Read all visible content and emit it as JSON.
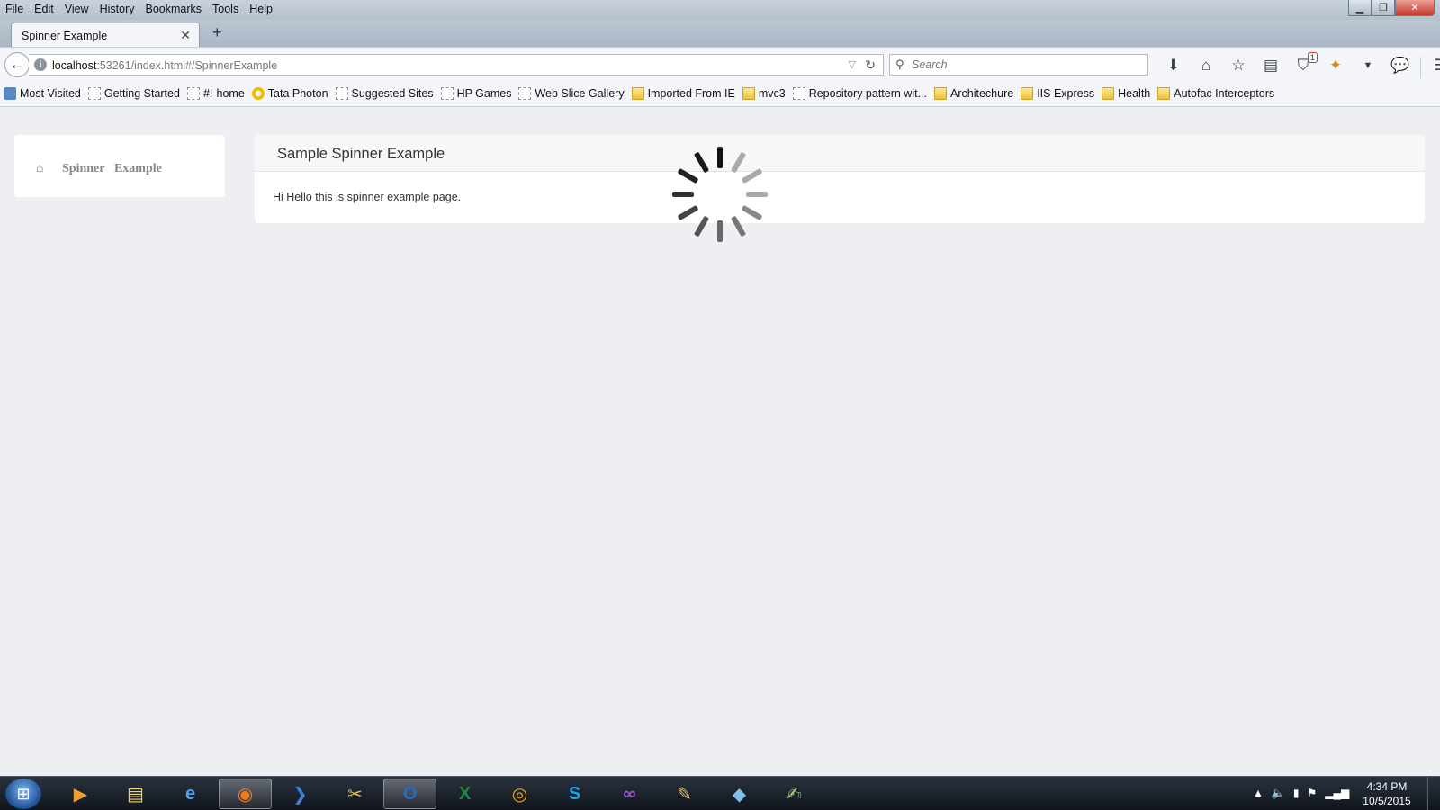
{
  "menubar": {
    "items": [
      "File",
      "Edit",
      "View",
      "History",
      "Bookmarks",
      "Tools",
      "Help"
    ],
    "window_controls": [
      "minimize",
      "maximize",
      "close"
    ]
  },
  "tabs": [
    {
      "title": "Spinner Example",
      "active": true
    }
  ],
  "navbar": {
    "url_host": "localhost",
    "url_rest": ":53261/index.html#/SpinnerExample",
    "search_placeholder": "Search",
    "toolbar_icons": [
      "download-icon",
      "home-icon",
      "bookmark-star-icon",
      "reading-list-icon",
      "pocket-icon",
      "addon-icon",
      "chevron-down-icon",
      "chat-icon",
      "menu-icon"
    ],
    "pocket_badge": "1"
  },
  "bookmarks": [
    {
      "label": "Most Visited",
      "icon": "most-visited-icon"
    },
    {
      "label": "Getting Started",
      "icon": "page-icon"
    },
    {
      "label": "#!-home",
      "icon": "page-icon"
    },
    {
      "label": "Tata Photon",
      "icon": "tata-icon"
    },
    {
      "label": "Suggested Sites",
      "icon": "page-icon"
    },
    {
      "label": "HP Games",
      "icon": "page-icon"
    },
    {
      "label": "Web Slice Gallery",
      "icon": "page-icon"
    },
    {
      "label": "Imported From IE",
      "icon": "folder-icon"
    },
    {
      "label": "mvc3",
      "icon": "folder-icon"
    },
    {
      "label": "Repository pattern wit...",
      "icon": "page-icon"
    },
    {
      "label": "Architechure",
      "icon": "folder-icon"
    },
    {
      "label": "IIS Express",
      "icon": "folder-icon"
    },
    {
      "label": "Health",
      "icon": "folder-icon"
    },
    {
      "label": "Autofac Interceptors",
      "icon": "folder-icon"
    }
  ],
  "page": {
    "breadcrumb_word1": "Spinner",
    "breadcrumb_word2": "Example",
    "panel_title": "Sample Spinner Example",
    "panel_body": "Hi Hello this is spinner example page."
  },
  "taskbar": {
    "apps": [
      {
        "name": "media-player",
        "glyph": "▶",
        "color": "#f0a030"
      },
      {
        "name": "file-explorer",
        "glyph": "▤",
        "color": "#f3d36b"
      },
      {
        "name": "internet-explorer",
        "glyph": "e",
        "color": "#4aa3f0"
      },
      {
        "name": "firefox",
        "glyph": "◉",
        "color": "#f07a20",
        "active": true
      },
      {
        "name": "powershell",
        "glyph": "❯",
        "color": "#3d7fd1"
      },
      {
        "name": "tools",
        "glyph": "✂",
        "color": "#d9c24a"
      },
      {
        "name": "outlook",
        "glyph": "O",
        "color": "#1e6fc9",
        "active": true
      },
      {
        "name": "excel",
        "glyph": "X",
        "color": "#1e8a3e"
      },
      {
        "name": "chrome",
        "glyph": "◎",
        "color": "#e2a522"
      },
      {
        "name": "skype",
        "glyph": "S",
        "color": "#1ba6e8"
      },
      {
        "name": "visual-studio",
        "glyph": "∞",
        "color": "#9a5cc9"
      },
      {
        "name": "paint",
        "glyph": "✎",
        "color": "#e9c46a"
      },
      {
        "name": "remote-desktop",
        "glyph": "◆",
        "color": "#7ec0e8"
      },
      {
        "name": "notepad",
        "glyph": "✍",
        "color": "#9fd36b"
      }
    ],
    "tray_icons": [
      "show-hidden-icon",
      "volume-icon",
      "power-icon",
      "flag-icon",
      "network-icon"
    ],
    "time": "4:34 PM",
    "date": "10/5/2015"
  }
}
